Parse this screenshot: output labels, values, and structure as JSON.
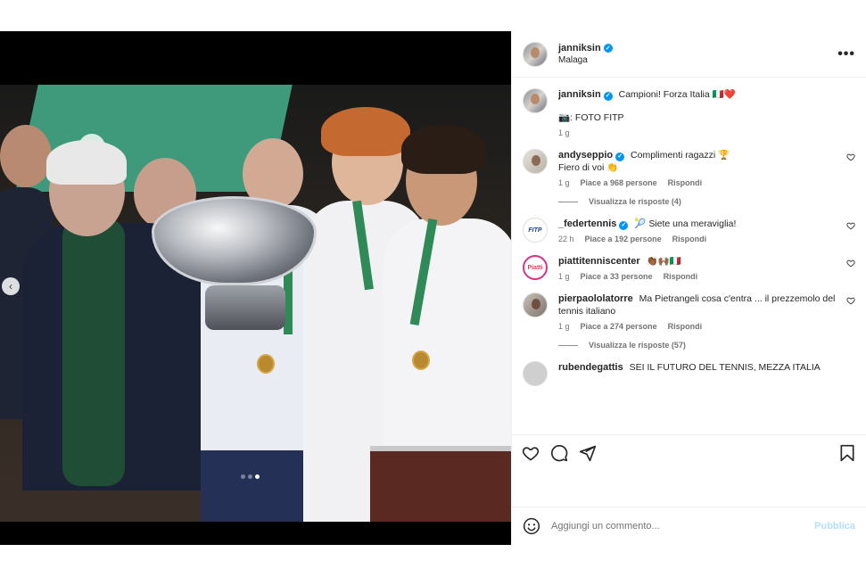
{
  "post": {
    "username": "janniksin",
    "location": "Malaga",
    "more_label": "•••"
  },
  "caption": {
    "username": "janniksin",
    "text": "Campioni! Forza Italia 🇮🇹❤️",
    "credit": "📷: FOTO FITP",
    "time": "1 g"
  },
  "comments": [
    {
      "username": "andyseppio",
      "verified": true,
      "text": "Complimenti ragazzi 🏆",
      "text2": "Fiero di voi 👏",
      "time": "1 g",
      "likes": "Piace a 968 persone",
      "reply": "Rispondi",
      "view_replies": "Visualizza le risposte (4)"
    },
    {
      "username": "_federtennis",
      "verified": true,
      "text": "🎾 Siete una meraviglia!",
      "time": "22 h",
      "likes": "Piace a 192 persone",
      "reply": "Rispondi"
    },
    {
      "username": "piattitenniscenter",
      "verified": false,
      "text": "👏🏾🙌🏾🇮🇹",
      "time": "1 g",
      "likes": "Piace a 33 persone",
      "reply": "Rispondi"
    },
    {
      "username": "pierpaololatorre",
      "verified": false,
      "text": "Ma Pietrangeli cosa c'entra ... il prezzemolo del tennis italiano",
      "time": "1 g",
      "likes": "Piace a 274 persone",
      "reply": "Rispondi",
      "view_replies": "Visualizza le risposte (57)"
    },
    {
      "username": "rubendegattis",
      "text": "SEI IL FUTURO DEL TENNIS, MEZZA ITALIA"
    }
  ],
  "avatars": {
    "fitp": "FITP",
    "piatti": "Piatti"
  },
  "composer": {
    "placeholder": "Aggiungi un commento...",
    "publish_label": "Pubblica"
  },
  "carousel": {
    "prev_label": "‹",
    "total": 3,
    "active_index": 2
  },
  "colors": {
    "verified_blue": "#0095f6",
    "publish_disabled": "#b2dffc",
    "meta_gray": "#737373"
  },
  "icons": {
    "like": "heart-icon",
    "comment": "comment-icon",
    "share": "share-icon",
    "save": "bookmark-icon",
    "emoji": "emoji-icon",
    "more": "more-icon"
  }
}
